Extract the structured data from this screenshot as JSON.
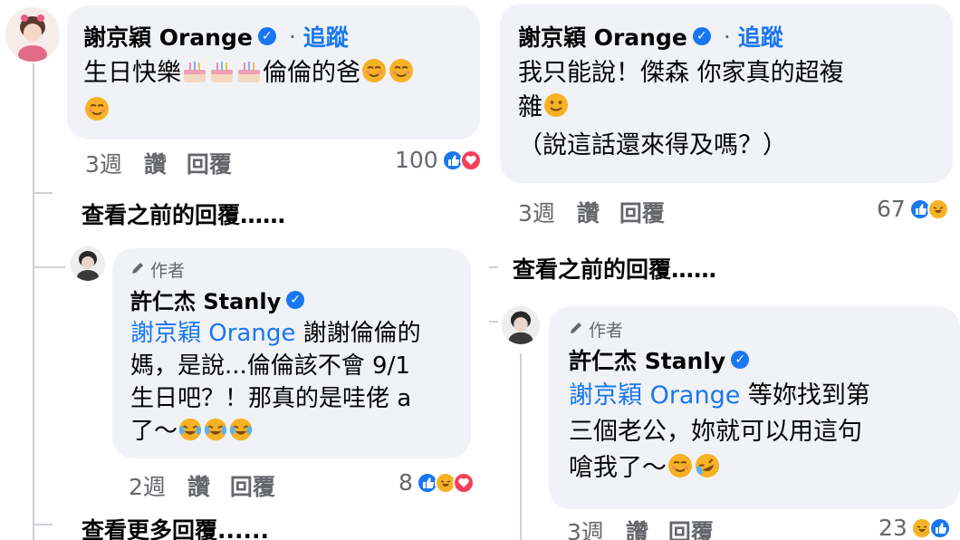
{
  "left": {
    "comment": {
      "author": "謝京穎 Orange",
      "follow_label": "追蹤",
      "dot": "·",
      "text_1": "生日快樂",
      "text_2": "倫倫的爸",
      "time": "3週",
      "like_label": "讚",
      "reply_label": "回覆",
      "reaction_count": "100"
    },
    "view_previous": "查看之前的回覆……",
    "reply": {
      "author_tag": "作者",
      "author": "許仁杰 Stanly",
      "mention": "謝京穎 Orange",
      "line_1": " 謝謝倫倫的",
      "line_2": "媽，是說...倫倫該不會 9/1",
      "line_3": "生日吧？！那真的是哇佬 a",
      "line_4": "了～",
      "time": "2週",
      "like_label": "讚",
      "reply_label": "回覆",
      "reaction_count": "8"
    },
    "view_more": "查看更多回覆......"
  },
  "right": {
    "comment": {
      "author": "謝京穎 Orange",
      "follow_label": "追蹤",
      "dot": "·",
      "line_1": "我只能說！傑森 你家真的超複",
      "line_2": "雜",
      "line_3": "（說這話還來得及嗎？）",
      "time": "3週",
      "like_label": "讚",
      "reply_label": "回覆",
      "reaction_count": "67"
    },
    "view_previous": "查看之前的回覆……",
    "reply": {
      "author_tag": "作者",
      "author": "許仁杰 Stanly",
      "mention": "謝京穎 Orange",
      "line_1": " 等妳找到第",
      "line_2": "三個老公，妳就可以用這句",
      "line_3": "嗆我了～",
      "time": "3週",
      "like_label": "讚",
      "reply_label": "回覆",
      "reaction_count": "23"
    }
  },
  "colors": {
    "bubble": "#f0f2f5",
    "link_blue": "#1877f2",
    "meta_gray": "#65676b",
    "like_blue": "#1877f2",
    "love_red": "#f33e58",
    "haha_yellow": "#f7b125"
  }
}
